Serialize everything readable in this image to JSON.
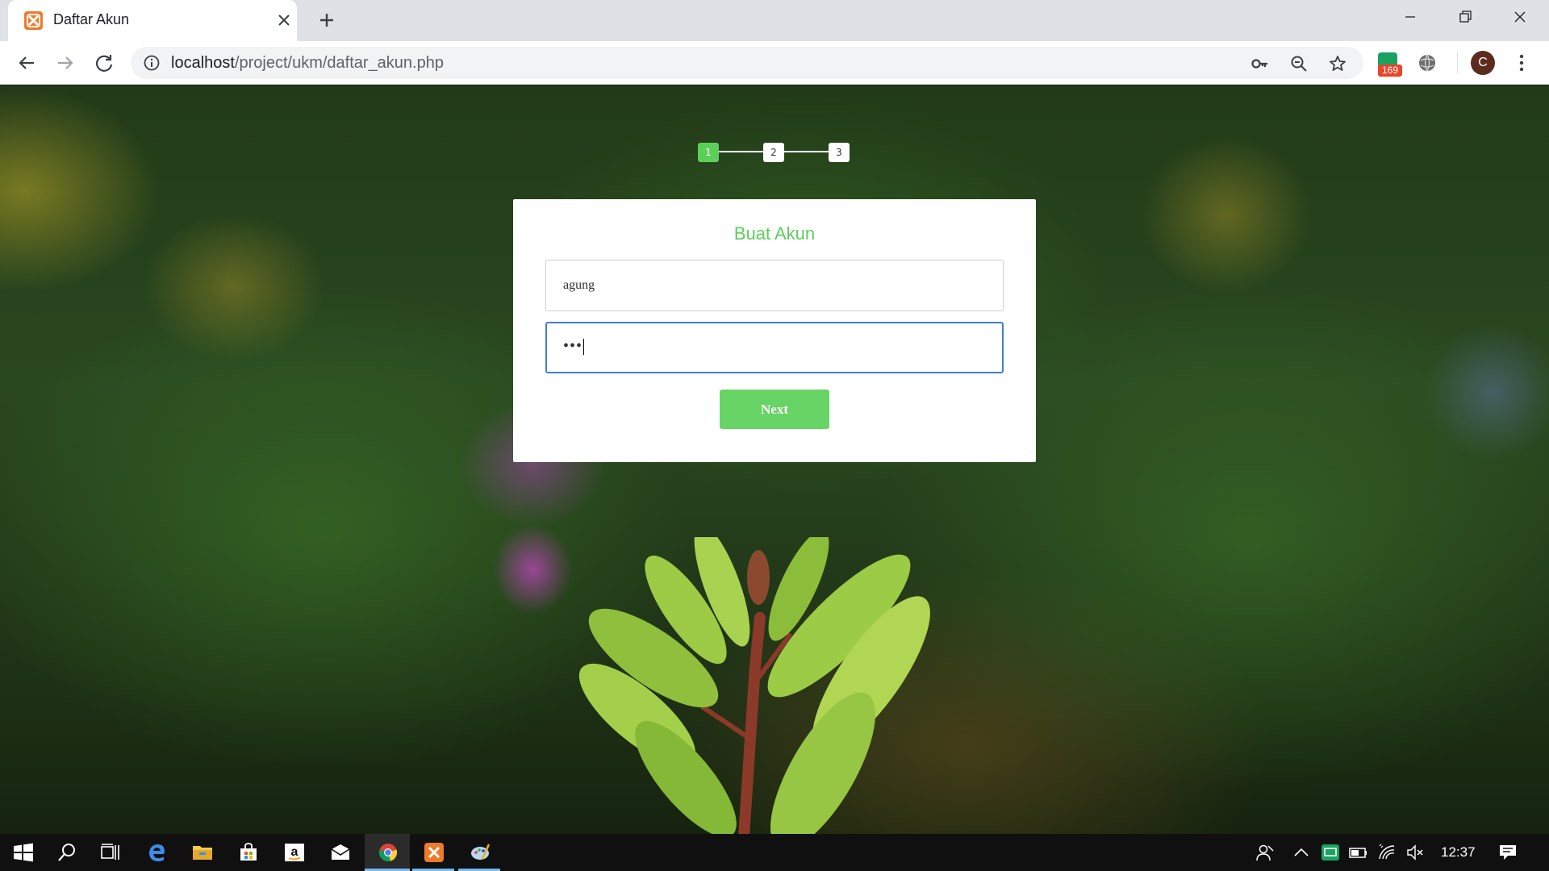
{
  "browser": {
    "tab": {
      "title": "Daftar Akun"
    },
    "address": {
      "host": "localhost",
      "path": "/project/ukm/daftar_akun.php"
    },
    "extension_badge": "169",
    "profile_initial": "C"
  },
  "stepper": {
    "steps": [
      "1",
      "2",
      "3"
    ],
    "active_step": 1
  },
  "form": {
    "title": "Buat Akun",
    "username_value": "agung",
    "password_value": "•••",
    "next_label": "Next"
  },
  "taskbar": {
    "time": "12:37"
  },
  "colors": {
    "accent_green": "#5ccf5a",
    "focus_blue": "#3f7fd1",
    "chrome_gray": "#dee1e6",
    "taskbar_black": "#101010"
  },
  "icons": [
    "xampp-icon",
    "back-arrow-icon",
    "forward-arrow-icon",
    "reload-icon",
    "info-icon",
    "key-icon",
    "zoom-icon",
    "star-icon",
    "menu-icon",
    "windows-start-icon",
    "search-icon",
    "task-view-icon",
    "edge-icon",
    "file-explorer-icon",
    "store-icon",
    "amazon-icon",
    "mail-icon",
    "chrome-icon",
    "paint-icon"
  ]
}
